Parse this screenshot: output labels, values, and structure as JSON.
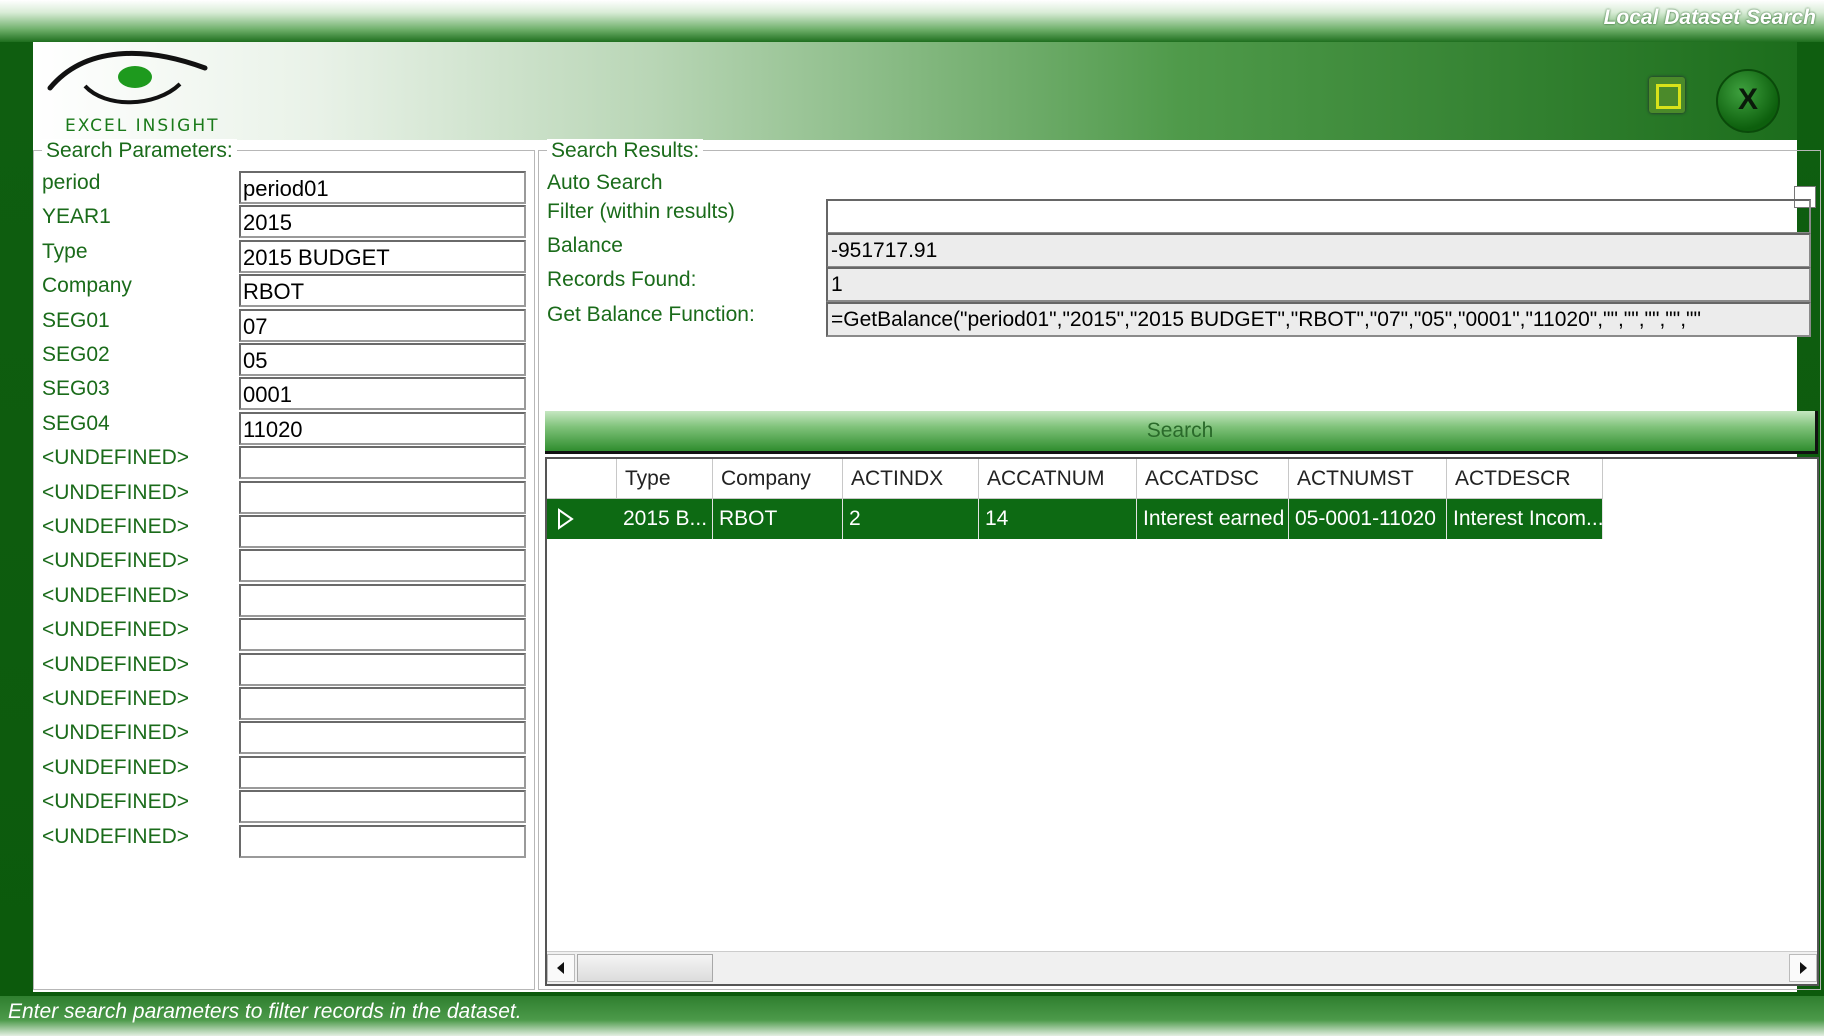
{
  "window": {
    "title": "Local Dataset Search"
  },
  "logo": {
    "text": "EXCEL INSIGHT"
  },
  "params": {
    "legend": "Search Parameters:",
    "rows": [
      {
        "label": "period",
        "value": "period01"
      },
      {
        "label": "YEAR1",
        "value": "2015"
      },
      {
        "label": "Type",
        "value": "2015 BUDGET"
      },
      {
        "label": "Company",
        "value": "RBOT"
      },
      {
        "label": "SEG01",
        "value": "07"
      },
      {
        "label": "SEG02",
        "value": "05"
      },
      {
        "label": "SEG03",
        "value": "0001"
      },
      {
        "label": "SEG04",
        "value": "11020"
      },
      {
        "label": "<UNDEFINED>",
        "value": ""
      },
      {
        "label": "<UNDEFINED>",
        "value": ""
      },
      {
        "label": "<UNDEFINED>",
        "value": ""
      },
      {
        "label": "<UNDEFINED>",
        "value": ""
      },
      {
        "label": "<UNDEFINED>",
        "value": ""
      },
      {
        "label": "<UNDEFINED>",
        "value": ""
      },
      {
        "label": "<UNDEFINED>",
        "value": ""
      },
      {
        "label": "<UNDEFINED>",
        "value": ""
      },
      {
        "label": "<UNDEFINED>",
        "value": ""
      },
      {
        "label": "<UNDEFINED>",
        "value": ""
      },
      {
        "label": "<UNDEFINED>",
        "value": ""
      },
      {
        "label": "<UNDEFINED>",
        "value": ""
      }
    ]
  },
  "results": {
    "legend": "Search Results:",
    "auto_search_label": "Auto Search",
    "auto_search_checked": false,
    "filter_label": "Filter (within results)",
    "filter_value": "",
    "balance_label": "Balance",
    "balance_value": "-951717.91",
    "records_label": "Records Found:",
    "records_value": "1",
    "function_label": "Get Balance Function:",
    "function_value": "=GetBalance(\"period01\",\"2015\",\"2015 BUDGET\",\"RBOT\",\"07\",\"05\",\"0001\",\"11020\",\"\",\"\",\"\",\"\",\"\"",
    "search_button": "Search"
  },
  "grid": {
    "columns": [
      "Type",
      "Company",
      "ACTINDX",
      "ACCATNUM",
      "ACCATDSC",
      "ACTNUMST",
      "ACTDESCR"
    ],
    "rows": [
      [
        "2015 B...",
        "RBOT",
        "2",
        "14",
        "Interest earned",
        "05-0001-11020",
        "Interest Incom..."
      ]
    ]
  },
  "status": {
    "text": "Enter search parameters to filter records in the dataset."
  },
  "colors": {
    "accent": "#0d6a13",
    "label": "#1a6b1a"
  }
}
